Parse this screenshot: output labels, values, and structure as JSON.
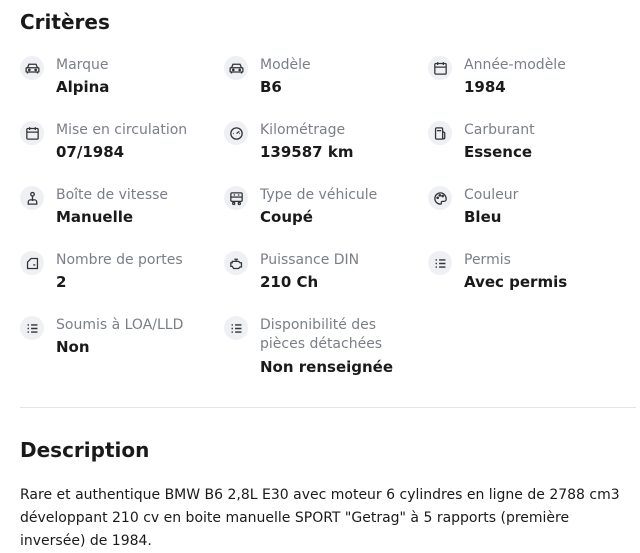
{
  "criteres": {
    "title": "Critères",
    "items": [
      {
        "icon": "car-icon",
        "label": "Marque",
        "value": "Alpina"
      },
      {
        "icon": "car-icon",
        "label": "Modèle",
        "value": "B6"
      },
      {
        "icon": "calendar-icon",
        "label": "Année-modèle",
        "value": "1984"
      },
      {
        "icon": "calendar-icon",
        "label": "Mise en circulation",
        "value": "07/1984"
      },
      {
        "icon": "speedometer-icon",
        "label": "Kilométrage",
        "value": "139587 km"
      },
      {
        "icon": "fuel-pump-icon",
        "label": "Carburant",
        "value": "Essence"
      },
      {
        "icon": "gear-shift-icon",
        "label": "Boîte de vitesse",
        "value": "Manuelle"
      },
      {
        "icon": "vehicle-type-icon",
        "label": "Type de véhicule",
        "value": "Coupé"
      },
      {
        "icon": "palette-icon",
        "label": "Couleur",
        "value": "Bleu"
      },
      {
        "icon": "door-icon",
        "label": "Nombre de portes",
        "value": "2"
      },
      {
        "icon": "engine-icon",
        "label": "Puissance DIN",
        "value": "210 Ch"
      },
      {
        "icon": "list-icon",
        "label": "Permis",
        "value": "Avec permis"
      },
      {
        "icon": "list-icon",
        "label": "Soumis à LOA/LLD",
        "value": "Non"
      },
      {
        "icon": "list-icon",
        "label": "Disponibilité des pièces détachées",
        "value": "Non renseignée"
      }
    ]
  },
  "description": {
    "title": "Description",
    "text": "Rare et authentique BMW B6 2,8L E30 avec moteur 6 cylindres en ligne de 2788 cm3 développant 210 cv en boite manuelle SPORT \"Getrag\" à 5 rapports (première inversée) de 1984."
  }
}
